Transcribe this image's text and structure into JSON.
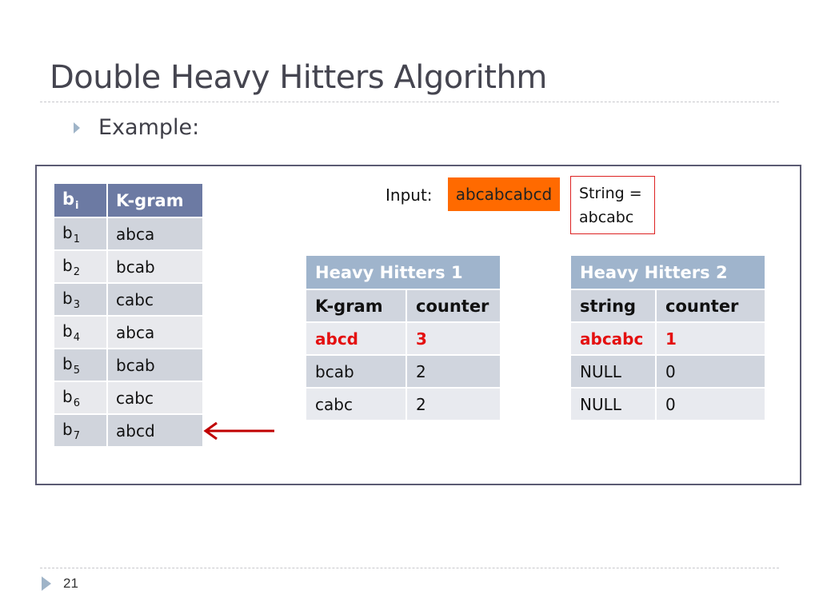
{
  "slide": {
    "title": "Double Heavy Hitters Algorithm",
    "bullet": "Example:",
    "page_number": "21"
  },
  "bi_table": {
    "headers": [
      "b",
      "i",
      "K-gram"
    ],
    "rows": [
      {
        "b": "b",
        "sub": "1",
        "kgram": "abca"
      },
      {
        "b": "b",
        "sub": "2",
        "kgram": "bcab"
      },
      {
        "b": "b",
        "sub": "3",
        "kgram": "cabc"
      },
      {
        "b": "b",
        "sub": "4",
        "kgram": "abca"
      },
      {
        "b": "b",
        "sub": "5",
        "kgram": "bcab"
      },
      {
        "b": "b",
        "sub": "6",
        "kgram": "cabc"
      },
      {
        "b": "b",
        "sub": "7",
        "kgram": "abcd"
      }
    ],
    "pointer": "current-row-arrow",
    "pointer_color": "#c00000"
  },
  "input": {
    "label": "Input:",
    "value": "abcabcabcd",
    "highlight_color": "#ff6a00"
  },
  "string_box": {
    "line1": "String =",
    "line2": "abcabc",
    "border_color": "#dd2222"
  },
  "heavy_hitters_1": {
    "title": "Heavy Hitters 1",
    "columns": [
      "K-gram",
      "counter"
    ],
    "rows": [
      [
        "abcd",
        "3"
      ],
      [
        "bcab",
        "2"
      ],
      [
        "cabc",
        "2"
      ]
    ],
    "highlight_color": "#e41010"
  },
  "heavy_hitters_2": {
    "title": "Heavy Hitters 2",
    "columns": [
      "string",
      "counter"
    ],
    "rows": [
      [
        "abcabc",
        "1"
      ],
      [
        "NULL",
        "0"
      ],
      [
        "NULL",
        "0"
      ]
    ],
    "highlight_color": "#e41010"
  }
}
